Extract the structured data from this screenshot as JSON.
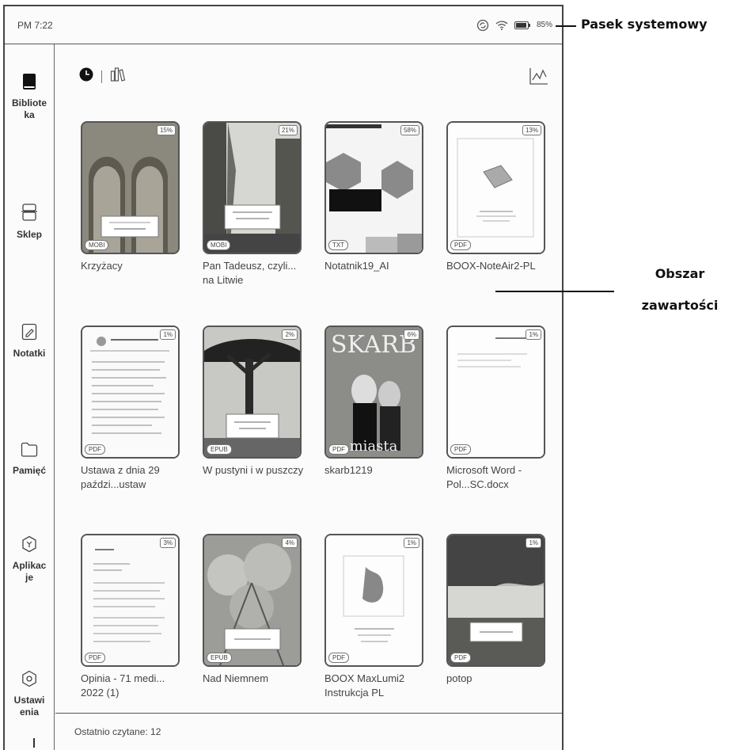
{
  "status": {
    "time": "PM 7:22",
    "battery": "85%"
  },
  "sidebar": {
    "items": [
      {
        "label": "Bibliote ka",
        "icon": "library-icon"
      },
      {
        "label": "Sklep",
        "icon": "store-icon"
      },
      {
        "label": "Notatki",
        "icon": "notes-icon"
      },
      {
        "label": "Pamięć",
        "icon": "folder-icon"
      },
      {
        "label": "Aplikac je",
        "icon": "apps-icon"
      },
      {
        "label": "Ustawi enia",
        "icon": "settings-icon"
      }
    ]
  },
  "toolbar": {
    "recent_icon": "clock-icon",
    "shelf_icon": "bookshelf-icon",
    "stats_icon": "chart-icon"
  },
  "books": [
    {
      "title": "Krzyżacy",
      "format": "MOBI",
      "progress": "15%"
    },
    {
      "title": "Pan Tadeusz, czyli... na Litwie",
      "format": "MOBI",
      "progress": "21%"
    },
    {
      "title": "Notatnik19_AI",
      "format": "TXT",
      "progress": "58%"
    },
    {
      "title": "BOOX-NoteAir2-PL",
      "format": "PDF",
      "progress": "13%"
    },
    {
      "title": "Ustawa z dnia 29 paździ...ustaw",
      "format": "PDF",
      "progress": "1%"
    },
    {
      "title": "W pustyni i w puszczy",
      "format": "EPUB",
      "progress": "2%"
    },
    {
      "title": "skarb1219",
      "format": "PDF",
      "progress": "6%"
    },
    {
      "title": "Microsoft Word - Pol...SC.docx",
      "format": "PDF",
      "progress": "1%"
    },
    {
      "title": "Opinia - 71 medi... 2022 (1)",
      "format": "PDF",
      "progress": "3%"
    },
    {
      "title": "Nad Niemnem",
      "format": "EPUB",
      "progress": "4%"
    },
    {
      "title": "BOOX MaxLumi2 Instrukcja PL",
      "format": "PDF",
      "progress": "1%"
    },
    {
      "title": "potop",
      "format": "PDF",
      "progress": "1%"
    }
  ],
  "footer": {
    "recent": "Ostatnio czytane: 12"
  },
  "callouts": {
    "statusbar": "Pasek systemowy",
    "content_1": "Obszar",
    "content_2": "zawartości"
  }
}
